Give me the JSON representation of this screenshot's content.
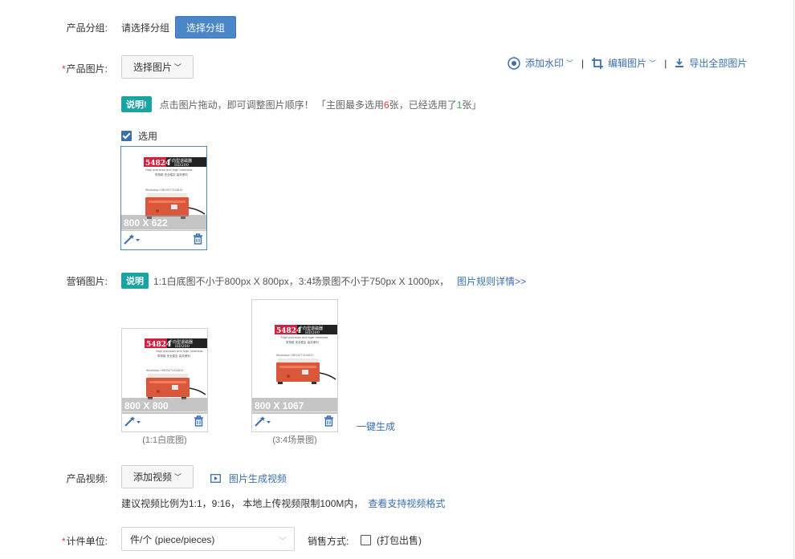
{
  "group": {
    "label": "产品分组:",
    "hint": "请选择分组",
    "button": "选择分组"
  },
  "product_images": {
    "required_mark": "*",
    "label": "产品图片:",
    "select_button": "选择图片",
    "toolbar": {
      "watermark": "添加水印",
      "edit": "编辑图片",
      "export": "导出全部图片",
      "separator": "|"
    },
    "note": {
      "badge": "说明!",
      "text_part1": "点击图片拖动，即可调整图片顺序！ 「主图最多选用",
      "max_count": "6",
      "text_part2": "张，已经选用了",
      "selected_count": "1",
      "text_part3": "张」"
    },
    "select_all_label": "选用",
    "select_all_checked": true,
    "images": [
      {
        "dimensions": "800 X 622",
        "selected": true
      }
    ]
  },
  "marketing_images": {
    "label": "营销图片:",
    "badge": "说明",
    "note": "1:1白底图不小于800px X 800px，3:4场景图不小于750px X 1000px，",
    "rules_link": "图片规则详情>>",
    "images": [
      {
        "dimensions": "800 X 800",
        "caption": "(1:1白底图)"
      },
      {
        "dimensions": "800 X 1067",
        "caption": "(3:4场景图)"
      }
    ],
    "generate_link": "一键生成"
  },
  "product_video": {
    "label": "产品视频:",
    "add_button": "添加视频",
    "generate_link": "图片生成视频",
    "hint": "建议视频比例为1:1，9:16， 本地上传视频限制100M内，",
    "formats_link": "查看支持视频格式"
  },
  "unit": {
    "required_mark": "*",
    "label": "计件单位:",
    "value": "件/个 (piece/pieces)",
    "sale_label": "销售方式:",
    "pack_option": "(打包出售)",
    "pack_checked": false
  },
  "product_photo": {
    "number": "54824",
    "title": "千向型退磁器",
    "model": "HD200",
    "subtitle": "High precision and high hardness",
    "features": "带按磁 安全稳定 高效便利",
    "contact": "WhatsApp:+8615071524620"
  },
  "colors": {
    "accent": "#4a86c8",
    "link": "#3a6fb2",
    "required": "#e4393c",
    "badge": "#19a3a3",
    "machine": "#d9573a"
  }
}
